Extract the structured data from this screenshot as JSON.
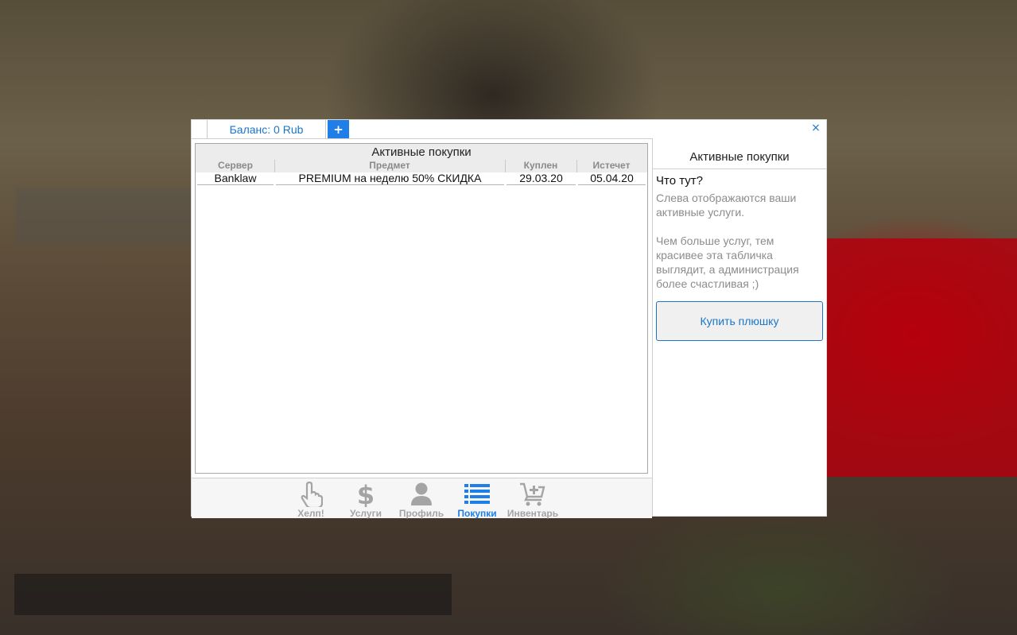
{
  "header": {
    "balance_tab": "Баланс: 0 Rub",
    "add_button": "+",
    "close_button": "×"
  },
  "table": {
    "title": "Активные покупки",
    "columns": [
      "Сервер",
      "Предмет",
      "Куплен",
      "Истечет"
    ],
    "rows": [
      [
        "Banklaw",
        "PREMIUM на неделю 50% СКИДКА",
        "29.03.20",
        "05.04.20"
      ]
    ]
  },
  "nav": {
    "items": [
      {
        "label": "Хелп!",
        "icon": "pointing-hand-icon",
        "active": false
      },
      {
        "label": "Услуги",
        "icon": "dollar-icon",
        "active": false
      },
      {
        "label": "Профиль",
        "icon": "user-icon",
        "active": false
      },
      {
        "label": "Покупки",
        "icon": "list-icon",
        "active": true
      },
      {
        "label": "Инвентарь",
        "icon": "cart-plus-icon",
        "active": false
      }
    ]
  },
  "sidebar": {
    "title": "Активные покупки",
    "question": "Что тут?",
    "paragraph1": "Слева отображаются ваши активные услуги.",
    "paragraph2": "Чем больше услуг, тем красивее эта табличка выглядит, а администрация более счастливая ;)",
    "buy_button": "Купить плюшку"
  },
  "colors": {
    "accent": "#1f7ee8",
    "link_blue": "#1a76c8",
    "muted_text": "#8c8c8c"
  }
}
